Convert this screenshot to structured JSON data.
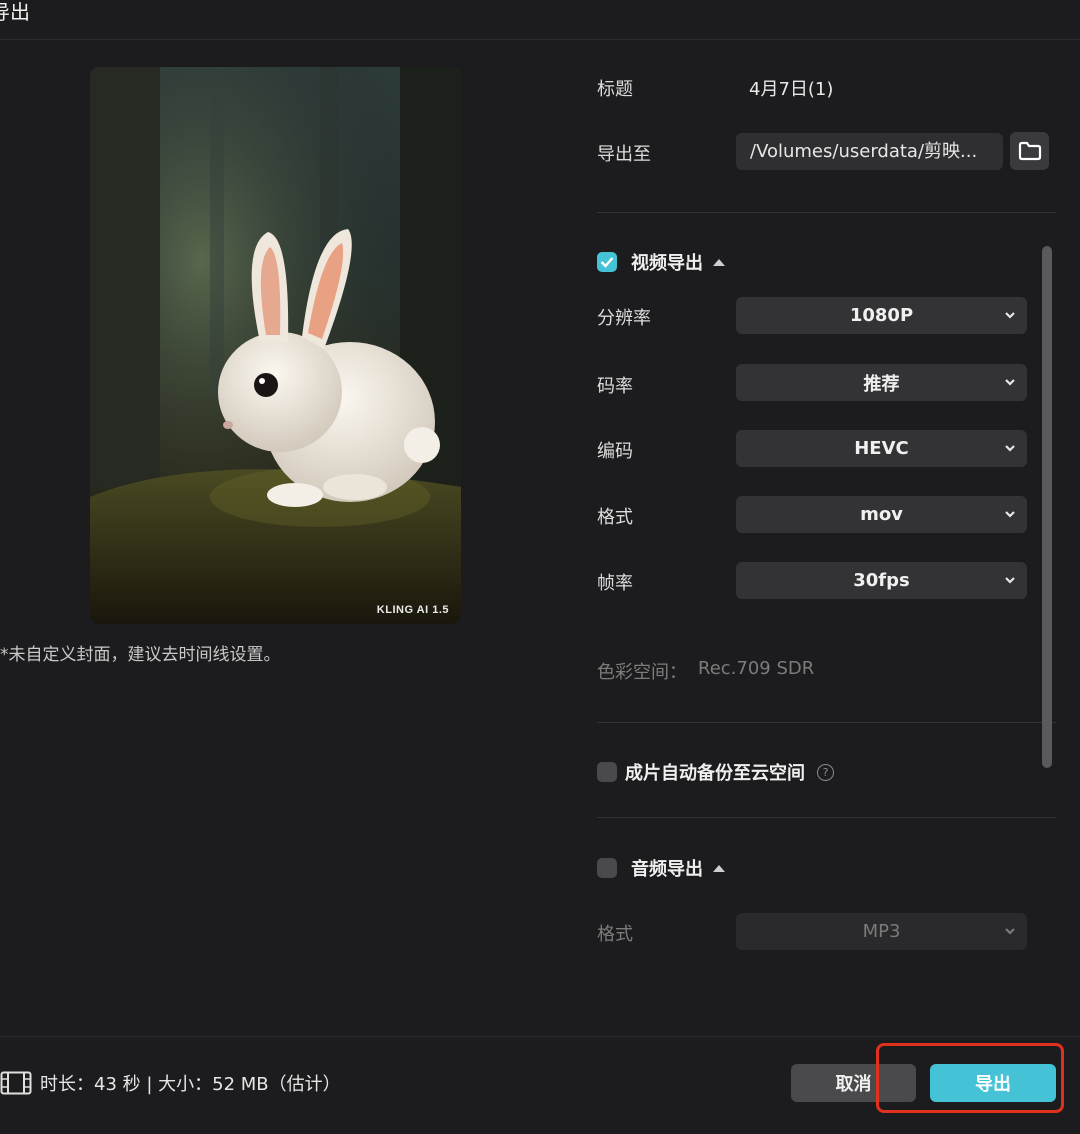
{
  "dialog": {
    "title": "导出"
  },
  "preview": {
    "watermark": "KLING AI 1.5",
    "cover_note": "*未自定义封面，建议去时间线设置。"
  },
  "fields": {
    "title_label": "标题",
    "title_value": "4月7日(1)",
    "export_to_label": "导出至",
    "export_path": "/Volumes/userdata/剪映..."
  },
  "video_export": {
    "checked": true,
    "label": "视频导出",
    "resolution_label": "分辨率",
    "resolution_value": "1080P",
    "bitrate_label": "码率",
    "bitrate_value": "推荐",
    "codec_label": "编码",
    "codec_value": "HEVC",
    "format_label": "格式",
    "format_value": "mov",
    "framerate_label": "帧率",
    "framerate_value": "30fps",
    "color_space_label": "色彩空间：",
    "color_space_value": "Rec.709 SDR"
  },
  "backup": {
    "checked": false,
    "label": "成片自动备份至云空间",
    "help": "?"
  },
  "audio_export": {
    "checked": false,
    "label": "音频导出",
    "format_label": "格式",
    "format_value": "MP3"
  },
  "footer": {
    "info": "时长：43 秒 | 大小：52 MB（估计）",
    "cancel_label": "取消",
    "export_label": "导出"
  },
  "colors": {
    "accent": "#45c2d6",
    "highlight": "#e0301e",
    "background": "#1c1c1e"
  }
}
